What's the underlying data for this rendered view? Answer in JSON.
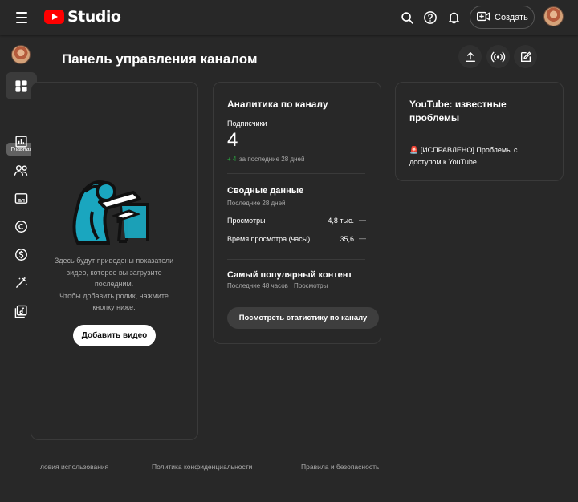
{
  "app": {
    "logo_text": "Studio",
    "create_label": "Создать",
    "active_nav_tooltip": "Главная"
  },
  "header": {
    "title": "Панель управления каналом"
  },
  "icons": {
    "menu": "hamburger-icon",
    "search": "search-icon",
    "help": "help-icon",
    "notifications": "bell-icon",
    "create": "video-plus-icon",
    "upload": "upload-icon",
    "live": "live-broadcast-icon",
    "edit": "edit-icon"
  },
  "sidebar": {
    "items": [
      {
        "label": "Главная",
        "icon": "dashboard-icon"
      },
      {
        "icon": "analytics-icon"
      },
      {
        "icon": "community-icon"
      },
      {
        "icon": "subtitles-icon"
      },
      {
        "icon": "copyright-icon"
      },
      {
        "icon": "earn-icon"
      },
      {
        "icon": "customization-icon"
      },
      {
        "icon": "audio-library-icon"
      }
    ]
  },
  "upload_card": {
    "text_1": "Здесь будут приведены показатели видео, которое вы загрузите последним.",
    "text_2": "Чтобы добавить ролик, нажмите кнопку ниже.",
    "button_label": "Добавить видео"
  },
  "analytics": {
    "title": "Аналитика по каналу",
    "subscribers_label": "Подписчики",
    "subscribers_value": "4",
    "subscribers_change": "+ 4",
    "subscribers_period": "за последние 28 дней",
    "summary_title": "Сводные данные",
    "summary_period": "Последние 28 дней",
    "metrics": [
      {
        "label": "Просмотры",
        "value": "4,8 тыс.",
        "trend": "—"
      },
      {
        "label": "Время просмотра (часы)",
        "value": "35,6",
        "trend": "—"
      }
    ],
    "popular_title": "Самый популярный контент",
    "popular_period": "Последние 48 часов · Просмотры",
    "button_label": "Посмотреть статистику по каналу"
  },
  "issues": {
    "title": "YouTube: известные проблемы",
    "item_text": "🚨 [ИСПРАВЛЕНО] Проблемы с доступом к YouTube"
  },
  "footer": {
    "terms": "ловия использования",
    "privacy": "Политика конфиденциальности",
    "safety": "Правила и безопасность"
  },
  "colors": {
    "background": "#282828",
    "brand_red": "#ff0000",
    "positive": "#2ba640",
    "muted_text": "#aaaaaa",
    "accent_cyan": "#1aa6bf"
  }
}
